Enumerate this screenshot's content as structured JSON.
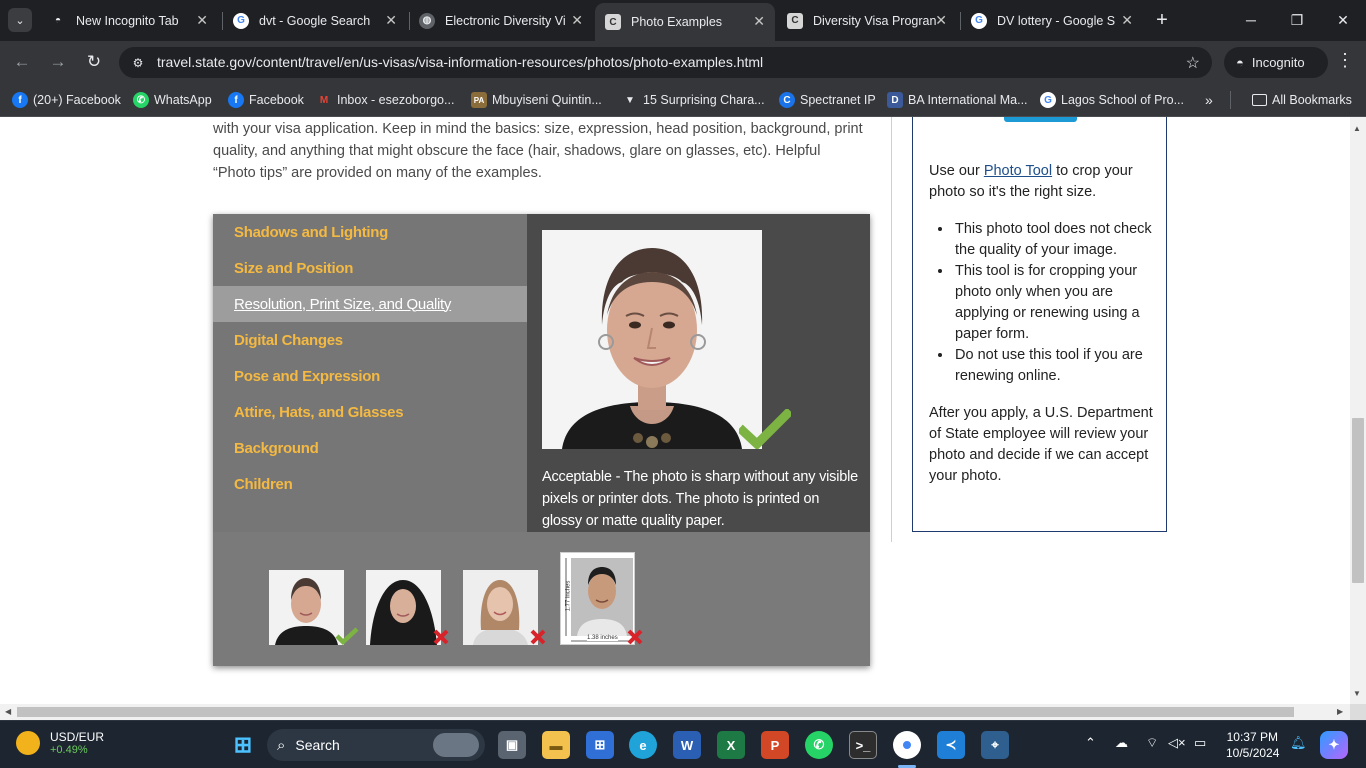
{
  "browser": {
    "tabs": [
      {
        "title": "New Incognito Tab",
        "icon": "incognito-icon"
      },
      {
        "title": "dvt - Google Search",
        "icon": "google-icon"
      },
      {
        "title": "Electronic Diversity Vi",
        "icon": "globe-icon"
      },
      {
        "title": "Photo Examples",
        "icon": "state-dept-icon"
      },
      {
        "title": "Diversity Visa Progran",
        "icon": "state-dept-icon"
      },
      {
        "title": "DV lottery - Google S",
        "icon": "google-icon"
      }
    ],
    "active_tab_index": 3,
    "url": "travel.state.gov/content/travel/en/us-visas/visa-information-resources/photos/photo-examples.html",
    "profile_label": "Incognito",
    "bookmarks": [
      {
        "label": "(20+) Facebook",
        "icon": "facebook-icon",
        "color": "#1877f2"
      },
      {
        "label": "WhatsApp",
        "icon": "whatsapp-icon",
        "color": "#25d366"
      },
      {
        "label": "Facebook",
        "icon": "facebook-icon",
        "color": "#1877f2"
      },
      {
        "label": "Inbox - esezoborgo...",
        "icon": "gmail-icon",
        "color": "#ea4335"
      },
      {
        "label": "Mbuyiseni Quintin...",
        "icon": "pa-icon",
        "color": "#8a6d3b"
      },
      {
        "label": "15 Surprising Chara...",
        "icon": "pin-icon",
        "color": "#222222"
      },
      {
        "label": "Spectranet IP",
        "icon": "spectranet-icon",
        "color": "#1a73e8"
      },
      {
        "label": "BA International Ma...",
        "icon": "d-icon",
        "color": "#3c5a99"
      },
      {
        "label": "Lagos School of Pro...",
        "icon": "google-icon",
        "color": "#4285f4"
      }
    ],
    "all_bookmarks_label": "All Bookmarks"
  },
  "page": {
    "intro_text": "with your visa application. Keep in mind the basics: size, expression, head position, background, print quality, and anything that might obscure the face (hair, shadows, glare on glasses, etc). Helpful “Photo tips” are provided on many of the examples.",
    "categories": [
      "Shadows and Lighting",
      "Size and Position",
      "Resolution, Print Size, and Quality",
      "Digital Changes",
      "Pose and Expression",
      "Attire, Hats, and Glasses",
      "Background",
      "Children"
    ],
    "selected_category_index": 2,
    "caption": "Acceptable - The photo is sharp without any visible pixels or printer dots. The photo is printed on glossy or matte quality paper.",
    "thumbnails": [
      {
        "name": "woman-gray-hair",
        "status": "acceptable"
      },
      {
        "name": "woman-hijab",
        "status": "unacceptable"
      },
      {
        "name": "young-woman",
        "status": "unacceptable"
      },
      {
        "name": "man-with-measurements",
        "status": "unacceptable"
      }
    ],
    "thumb_dimension_label": "1.38 inches",
    "thumb_dimension_label_v": "1.77 inches",
    "sidebar": {
      "line_before_link": "Use our ",
      "link_text": "Photo Tool",
      "line_after_link": " to crop your photo so it's the right size.",
      "bullets": [
        "This photo tool does not check the quality of your image.",
        "This tool is for cropping your photo only when you are applying or renewing using a paper form.",
        "Do not use this tool if you are renewing online."
      ],
      "closing": "After you apply, a U.S. Department of State employee will review your photo and decide if we can accept your photo."
    }
  },
  "taskbar": {
    "ticker_symbol": "USD/EUR",
    "ticker_change": "+0.49%",
    "search_label": "Search",
    "time": "10:37 PM",
    "date": "10/5/2024",
    "colors": {
      "accept": "#7cb342",
      "reject": "#d8232a"
    }
  }
}
